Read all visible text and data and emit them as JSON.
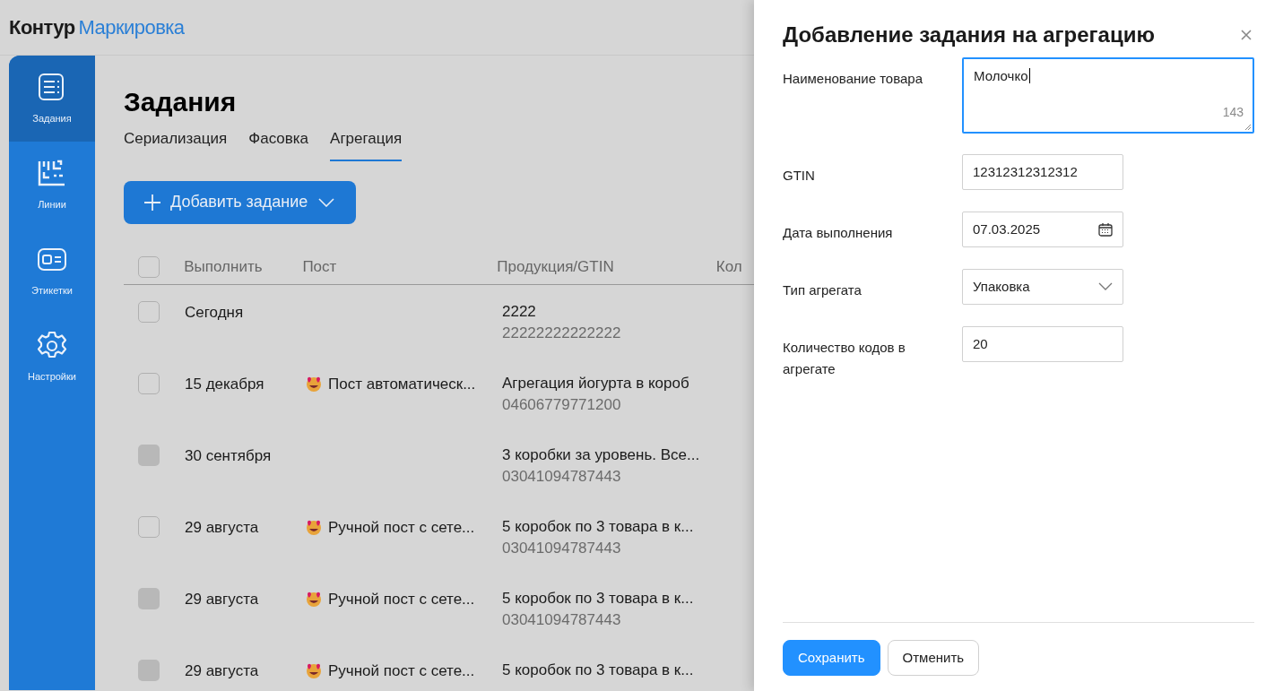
{
  "brand": {
    "part_1": "Контур",
    "part_2": "Маркировка"
  },
  "sidebar": {
    "items": [
      {
        "label": "Задания",
        "kind": "list",
        "selected": true
      },
      {
        "label": "Линии",
        "kind": "lines",
        "selected": false
      },
      {
        "label": "Этикетки",
        "kind": "label",
        "selected": false
      },
      {
        "label": "Настройки",
        "kind": "gear",
        "selected": false
      }
    ]
  },
  "page_title": "Задания",
  "tabs": [
    {
      "label": "Сериализация",
      "selected": false
    },
    {
      "label": "Фасовка",
      "selected": false
    },
    {
      "label": "Агрегация",
      "selected": true
    }
  ],
  "add_button": {
    "label": "Добавить задание"
  },
  "table": {
    "select_all": {
      "checked": false
    },
    "columns": [
      "Выполнить",
      "Пост",
      "Продукция/GTIN",
      "Кол"
    ],
    "rows": [
      {
        "date": "Сегодня",
        "product": "2222",
        "gtin": "22222222222222",
        "disabled": false
      },
      {
        "date": "15 декабря",
        "post": "Пост автоматическ...",
        "product": "Агрегация йогурта в короб",
        "gtin": "04606779771200",
        "disabled": false
      },
      {
        "date": "30 сентября",
        "product": "3 коробки за уровень. Все...",
        "gtin": "03041094787443",
        "disabled": true
      },
      {
        "date": "29 августа",
        "post": "Ручной пост с сете...",
        "product": "5 коробок по 3 товара в к...",
        "gtin": "03041094787443",
        "disabled": false
      },
      {
        "date": "29 августа",
        "post": "Ручной пост с сете...",
        "product": "5 коробок по 3 товара в к...",
        "gtin": "03041094787443",
        "disabled": true
      },
      {
        "date": "29 августа",
        "post": "Ручной пост с сете...",
        "product": "5 коробок по 3 товара в к...",
        "disabled": true
      }
    ]
  },
  "panel": {
    "title": "Добавление задания на агрегацию",
    "fields": [
      {
        "kind": "textarea",
        "label": "Наименование товара",
        "value": "Молочко",
        "counter": "143"
      },
      {
        "kind": "text",
        "label": "GTIN",
        "value": "12312312312312"
      },
      {
        "kind": "date",
        "label": "Дата выполнения",
        "value": "07.03.2025"
      },
      {
        "kind": "select",
        "label": "Тип агрегата",
        "value": "Упаковка"
      },
      {
        "kind": "text",
        "label": "Количество кодов в агрегате",
        "value": "20"
      }
    ],
    "buttons": [
      {
        "label": "Сохранить",
        "kind": "primary"
      },
      {
        "label": "Отменить",
        "kind": "secondary"
      }
    ]
  }
}
